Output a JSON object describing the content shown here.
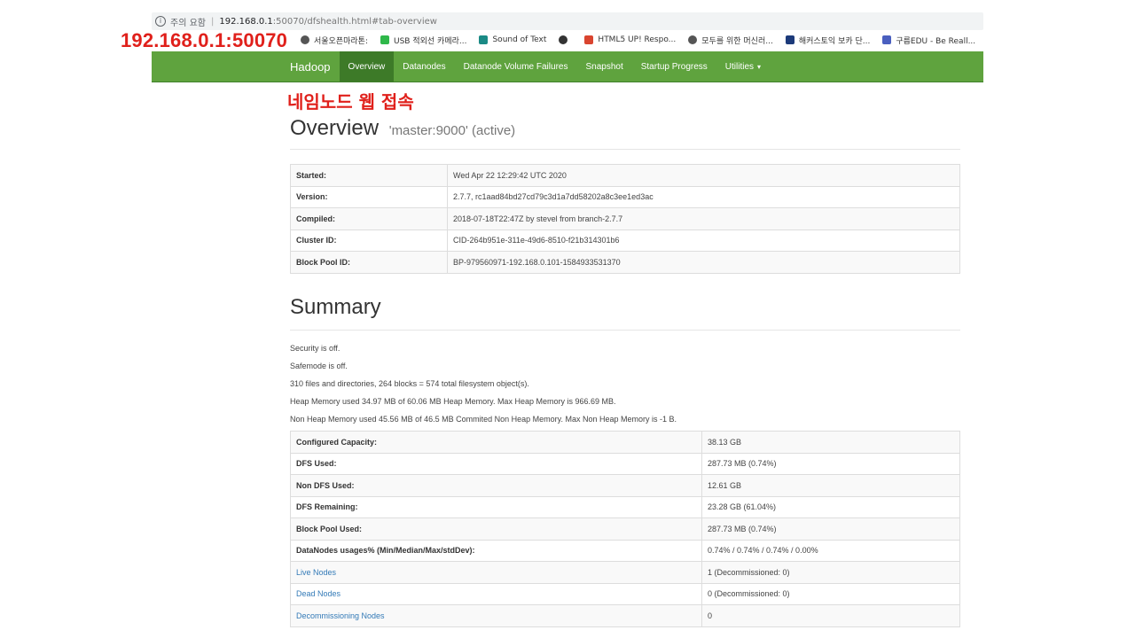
{
  "browser": {
    "security_label": "주의 요함",
    "url_host": "192.168.0.1",
    "url_path": ":50070/dfshealth.html#tab-overview",
    "bookmarks": [
      {
        "label": "서울오픈마라톤:",
        "icon": "globe-icon",
        "color": "#555555"
      },
      {
        "label": "USB 적외선 카메라...",
        "icon": "green-square-icon",
        "color": "#2fb84a"
      },
      {
        "label": "Sound of Text",
        "icon": "teal-square-icon",
        "color": "#1a8a85"
      },
      {
        "label": "",
        "icon": "gear-icon",
        "color": "#333333"
      },
      {
        "label": "HTML5 UP! Respo...",
        "icon": "red-square-icon",
        "color": "#d9442f"
      },
      {
        "label": "모두를 위한 머신러...",
        "icon": "globe-icon",
        "color": "#555555"
      },
      {
        "label": "해커스토익 보카 단...",
        "icon": "h-square-icon",
        "color": "#1c3a7a"
      },
      {
        "label": "구름EDU - Be Reall...",
        "icon": "cloud-icon",
        "color": "#4a5fbf"
      }
    ]
  },
  "annotations": {
    "ip": "192.168.0.1:50070",
    "title": "네임노드 웹 접속"
  },
  "nav": {
    "brand": "Hadoop",
    "items": [
      "Overview",
      "Datanodes",
      "Datanode Volume Failures",
      "Snapshot",
      "Startup Progress",
      "Utilities"
    ],
    "active": "Overview",
    "color": "#5fa33e"
  },
  "overview": {
    "title": "Overview",
    "subtitle": "'master:9000' (active)",
    "rows": [
      {
        "key": "Started:",
        "value": "Wed Apr 22 12:29:42 UTC 2020"
      },
      {
        "key": "Version:",
        "value": "2.7.7, rc1aad84bd27cd79c3d1a7dd58202a8c3ee1ed3ac"
      },
      {
        "key": "Compiled:",
        "value": "2018-07-18T22:47Z by stevel from branch-2.7.7"
      },
      {
        "key": "Cluster ID:",
        "value": "CID-264b951e-311e-49d6-8510-f21b314301b6"
      },
      {
        "key": "Block Pool ID:",
        "value": "BP-979560971-192.168.0.101-1584933531370"
      }
    ]
  },
  "summary": {
    "title": "Summary",
    "lines": [
      "Security is off.",
      "Safemode is off.",
      "310 files and directories, 264 blocks = 574 total filesystem object(s).",
      "Heap Memory used 34.97 MB of 60.06 MB Heap Memory. Max Heap Memory is 966.69 MB.",
      "Non Heap Memory used 45.56 MB of 46.5 MB Commited Non Heap Memory. Max Non Heap Memory is -1 B."
    ],
    "rows": [
      {
        "key": "Configured Capacity:",
        "value": "38.13 GB"
      },
      {
        "key": "DFS Used:",
        "value": "287.73 MB (0.74%)"
      },
      {
        "key": "Non DFS Used:",
        "value": "12.61 GB"
      },
      {
        "key": "DFS Remaining:",
        "value": "23.28 GB (61.04%)"
      },
      {
        "key": "Block Pool Used:",
        "value": "287.73 MB (0.74%)"
      },
      {
        "key": "DataNodes usages% (Min/Median/Max/stdDev):",
        "value": "0.74% / 0.74% / 0.74% / 0.00%"
      },
      {
        "key": "Live Nodes",
        "value": "1 (Decommissioned: 0)",
        "link": true
      },
      {
        "key": "Dead Nodes",
        "value": "0 (Decommissioned: 0)",
        "link": true
      },
      {
        "key": "Decommissioning Nodes",
        "value": "0",
        "link": true
      }
    ]
  }
}
